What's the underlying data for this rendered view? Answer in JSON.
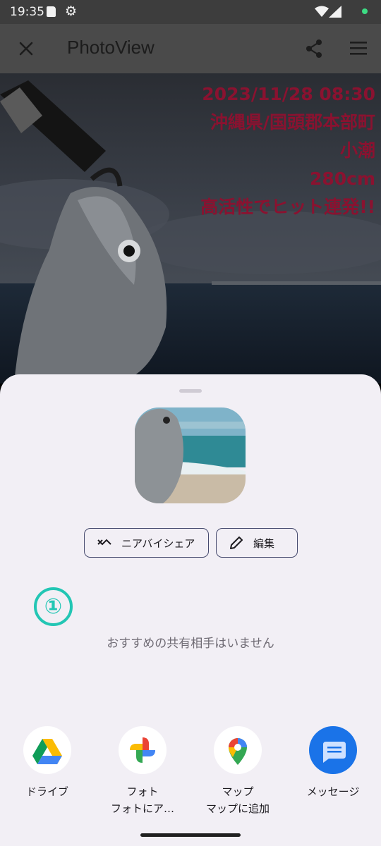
{
  "status_bar": {
    "time": "19:35",
    "icons": [
      "sd-card-icon",
      "settings-icon",
      "wifi-icon",
      "signal-icon",
      "privacy-dot-icon"
    ]
  },
  "app_bar": {
    "title": "PhotoView",
    "icons": [
      "close-icon",
      "share-icon",
      "menu-icon"
    ]
  },
  "photo_overlay": {
    "lines": [
      "2023/11/28 08:30",
      "沖縄県/国頭郡本部町",
      "小潮",
      "280cm",
      "高活性でヒット連発!!"
    ],
    "color": "#8a1230"
  },
  "share_sheet": {
    "chips": [
      {
        "label": "ニアバイシェア",
        "icon": "nearby-share-icon"
      },
      {
        "label": "編集",
        "icon": "pencil-icon"
      }
    ],
    "badge": "①",
    "empty_message": "おすすめの共有相手はいません",
    "apps": [
      {
        "name": "ドライブ",
        "sub": "",
        "icon": "google-drive-icon"
      },
      {
        "name": "フォト",
        "sub": "フォトにア…",
        "icon": "google-photos-icon"
      },
      {
        "name": "マップ",
        "sub": "マップに追加",
        "icon": "google-maps-icon"
      },
      {
        "name": "メッセージ",
        "sub": "",
        "icon": "messages-icon"
      }
    ]
  },
  "colors": {
    "sheet_bg": "#f2eff5",
    "chip_border": "#464a6e",
    "badge": "#23c6b4",
    "scrim_bar": "#4a4a4a"
  }
}
